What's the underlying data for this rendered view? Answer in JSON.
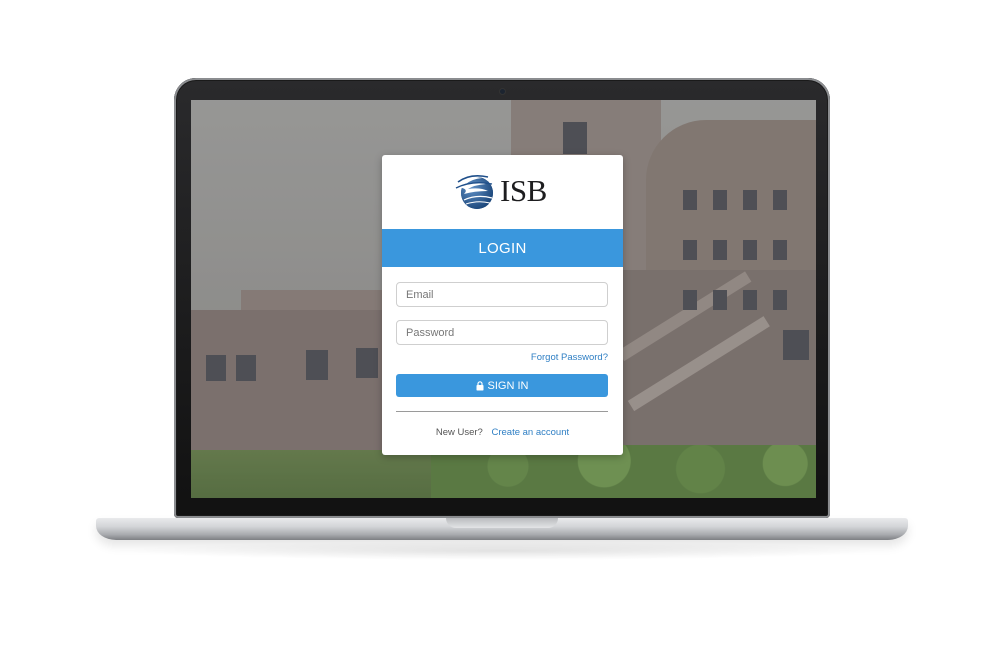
{
  "brand": {
    "logo_text": "ISB",
    "accent_color": "#3a97dd",
    "link_color": "#2f7fc4"
  },
  "login": {
    "header": "LOGIN",
    "email_placeholder": "Email",
    "password_placeholder": "Password",
    "forgot_password": "Forgot Password?",
    "sign_in_label": "SIGN IN",
    "sign_in_icon": "lock-icon",
    "new_user_text": "New User?",
    "create_account": "Create an account"
  }
}
